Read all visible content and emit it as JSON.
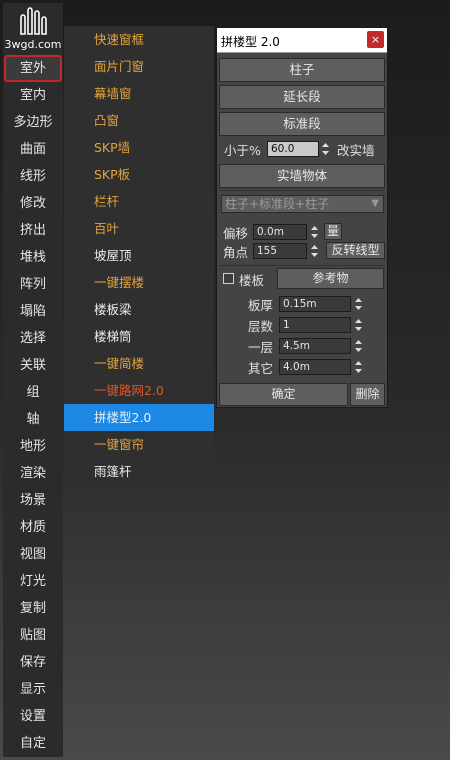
{
  "logo": {
    "text": "3wgd.com"
  },
  "sidebar": {
    "items": [
      "室外",
      "室内",
      "多边形",
      "曲面",
      "线形",
      "修改",
      "挤出",
      "堆栈",
      "阵列",
      "塌陷",
      "选择",
      "关联",
      "组",
      "轴",
      "地形",
      "渲染",
      "场景",
      "材质",
      "视图",
      "灯光",
      "复制",
      "贴图",
      "保存",
      "显示",
      "设置",
      "自定"
    ]
  },
  "submenu": {
    "items": [
      {
        "label": "快速窗框",
        "color": "orange"
      },
      {
        "label": "面片门窗",
        "color": "orange"
      },
      {
        "label": "幕墙窗",
        "color": "orange"
      },
      {
        "label": "凸窗",
        "color": "orange"
      },
      {
        "label": "SKP墙",
        "color": "orange"
      },
      {
        "label": "SKP板",
        "color": "orange"
      },
      {
        "label": "栏杆",
        "color": "orange"
      },
      {
        "label": "百叶",
        "color": "orange"
      },
      {
        "label": "坡屋顶",
        "color": "white"
      },
      {
        "label": "一键摆楼",
        "color": "orange"
      },
      {
        "label": "楼板梁",
        "color": "white"
      },
      {
        "label": "楼梯筒",
        "color": "white"
      },
      {
        "label": "一键简楼",
        "color": "orange"
      },
      {
        "label": "一键路网2.0",
        "color": "red"
      },
      {
        "label": "拼楼型2.0",
        "color": "selected"
      },
      {
        "label": "一键窗帘",
        "color": "orange"
      },
      {
        "label": "雨篷杆",
        "color": "white"
      }
    ]
  },
  "dialog": {
    "title": "拼楼型 2.0",
    "close": "×",
    "btn_column": "柱子",
    "btn_extend": "延长段",
    "btn_standard": "标准段",
    "less_than_label": "小于%",
    "less_than_value": "60.0",
    "change_wall_label": "改实墙",
    "btn_solid_wall": "实墙物体",
    "combo_value": "柱子+标准段+柱子",
    "offset_label": "偏移",
    "offset_value": "0.0m",
    "measure_btn": "量",
    "angle_label": "角点",
    "angle_value": "155",
    "reverse_btn": "反转线型",
    "floor_label": "楼板",
    "ref_btn": "参考物",
    "thickness_label": "板厚",
    "thickness_value": "0.15m",
    "layers_label": "层数",
    "layers_value": "1",
    "first_floor_label": "一层",
    "first_floor_value": "4.5m",
    "other_label": "其它",
    "other_value": "4.0m",
    "ok_btn": "确定",
    "delete_btn": "删除"
  },
  "colors": {
    "orange": "#e3a33c",
    "red": "#e0562a",
    "selected": "#1e88e5",
    "active_border": "#c0282a"
  }
}
